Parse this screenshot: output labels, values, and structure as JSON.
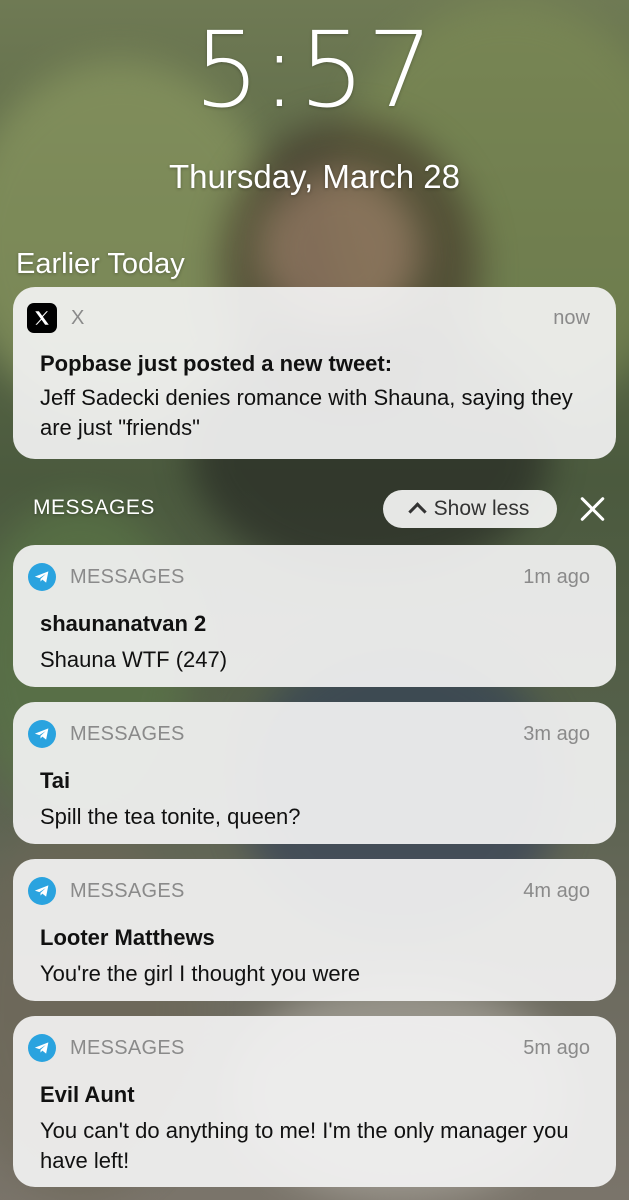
{
  "lock_screen": {
    "time": "5:57",
    "date": "Thursday, March 28"
  },
  "section": {
    "title": "Earlier Today"
  },
  "x_notification": {
    "app": "X",
    "time": "now",
    "title": "Popbase just posted a new tweet:",
    "body": "Jeff Sadecki denies romance with Shauna, saying they are just \"friends\""
  },
  "messages_group": {
    "title": "MESSAGES",
    "show_less_label": "Show less"
  },
  "messages": [
    {
      "app": "MESSAGES",
      "time": "1m ago",
      "sender": "shaunanatvan 2",
      "text": "Shauna WTF (247)"
    },
    {
      "app": "MESSAGES",
      "time": "3m ago",
      "sender": "Tai",
      "text": "Spill the tea tonite, queen?"
    },
    {
      "app": "MESSAGES",
      "time": "4m ago",
      "sender": "Looter Matthews",
      "text": "You're the girl I thought you were"
    },
    {
      "app": "MESSAGES",
      "time": "5m ago",
      "sender": "Evil Aunt",
      "text": "You can't do anything to me! I'm the only manager you have left!"
    }
  ],
  "icons": {
    "x_app": "x-logo-icon",
    "messages_app": "telegram-plane-icon",
    "show_less": "chevron-up-icon",
    "close": "close-icon"
  },
  "colors": {
    "card_bg": "#f2f2f2",
    "telegram_blue": "#2aa3df",
    "muted_text": "#8a8a8a"
  }
}
